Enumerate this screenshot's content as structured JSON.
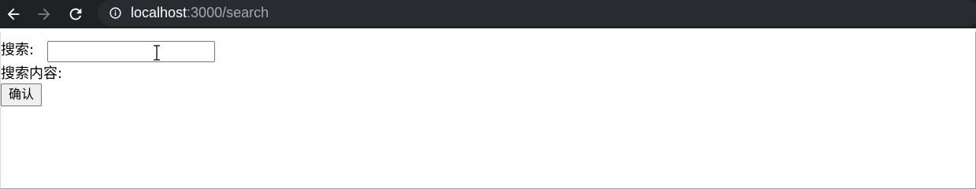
{
  "browser": {
    "url_host": "localhost",
    "url_path": ":3000/search",
    "back_icon": "arrow-left-icon",
    "forward_icon": "arrow-right-icon",
    "reload_icon": "reload-icon",
    "info_icon": "info-circle-icon",
    "colors": {
      "toolbar_bg": "#202124",
      "omnibox_bg": "#282b2f",
      "host_text": "#ffffff",
      "path_text": "#a5a8ac",
      "forward_disabled": "#7b7e82"
    }
  },
  "page": {
    "search_label": "搜索:",
    "search_input_value": "",
    "search_input_placeholder": "",
    "result_label": "搜索内容:",
    "result_value": "",
    "confirm_button_label": "确认"
  }
}
